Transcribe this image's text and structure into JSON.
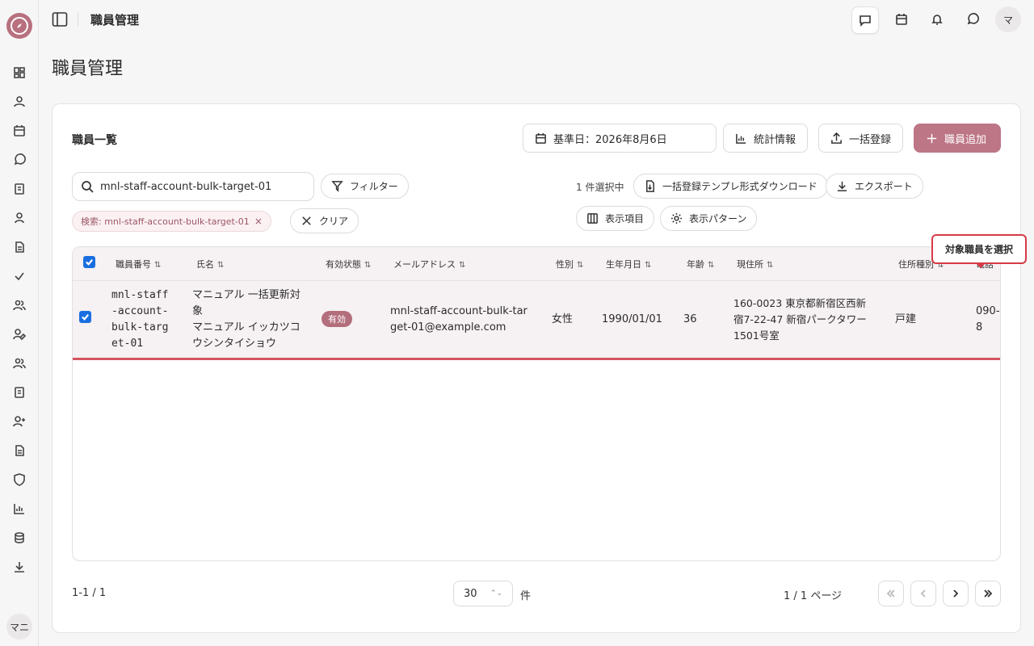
{
  "app": {
    "title": "職員管理",
    "user_initial": "マ",
    "bottom_user": "マニ"
  },
  "page": {
    "title": "職員管理"
  },
  "card": {
    "title": "職員一覧",
    "date_label": "基準日：2026年8月6日",
    "stats_label": "統計情報",
    "bulk_register_label": "一括登録",
    "add_staff_label": "職員追加",
    "filter_label": "フィルター",
    "selected_text": "1 件選択中",
    "template_download_label": "一括登録テンプレ形式ダウンロード",
    "export_label": "エクスポート",
    "columns_label": "表示項目",
    "pattern_label": "表示パターン",
    "clear_label": "クリア"
  },
  "search": {
    "value": "mnl-staff-account-bulk-target-01",
    "chip": "検索: mnl-staff-account-bulk-target-01",
    "chip_close": "×"
  },
  "table": {
    "headers": {
      "staff_no": "職員番号",
      "name": "氏名",
      "status": "有効状態",
      "email": "メールアドレス",
      "gender": "性別",
      "birthdate": "生年月日",
      "age": "年齢",
      "address": "現住所",
      "address_type": "住所種別",
      "phone": "電話"
    },
    "sort_glyph": "⇅",
    "rows": [
      {
        "staff_no_l1": "mnl-staff",
        "staff_no_l2": "-account-",
        "staff_no_l3": "bulk-targ",
        "staff_no_l4": "et-01",
        "name_l1": "マニュアル 一括更新対",
        "name_l2": "象",
        "name_l3": "マニュアル イッカツコ",
        "name_l4": "ウシンタイショウ",
        "status": "有効",
        "email_l1": "mnl-staff-account-bulk-tar",
        "email_l2": "get-01@example.com",
        "gender": "女性",
        "birthdate": "1990/01/01",
        "age": "36",
        "address_l1": "160-0023 東京都新宿区西新",
        "address_l2": "宿7-22-47 新宿パークタワー",
        "address_l3": "1501号室",
        "address_type": "戸建",
        "phone_l1": "090-",
        "phone_l2": "8"
      }
    ]
  },
  "tooltip": {
    "text": "対象職員を選択"
  },
  "pagination": {
    "range": "1-1 / 1",
    "per_page": "30",
    "per_page_unit": "件",
    "page_info": "1 / 1 ページ"
  },
  "colors": {
    "accent": "#bd7686",
    "badge": "#b36e7c",
    "highlight_border": "#d5555f",
    "checkbox": "#1a6fe0"
  }
}
